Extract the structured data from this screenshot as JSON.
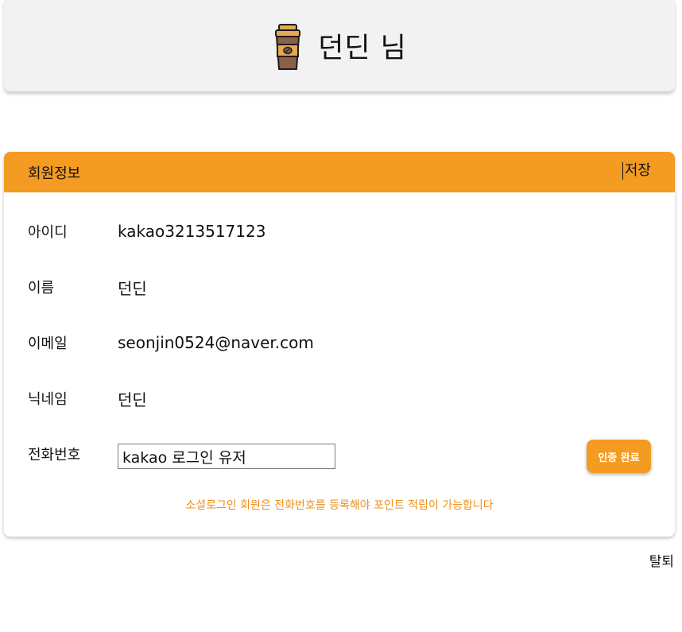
{
  "header": {
    "icon": "coffee-cup-icon",
    "title": "던딘 님"
  },
  "profile": {
    "section_title": "회원정보",
    "save_label": "저장",
    "fields": [
      {
        "label": "아이디",
        "value": "kakao3213517123"
      },
      {
        "label": "이름",
        "value": "던딘"
      },
      {
        "label": "이메일",
        "value": "seonjin0524@naver.com"
      },
      {
        "label": "닉네임",
        "value": "던딘"
      }
    ],
    "phone": {
      "label": "전화번호",
      "value": "kakao 로그인 유저",
      "verify_label": "인증 완료"
    },
    "notice": "소셜로그인 회원은 전화번호를 등록해야 포인트 적립이 가능합니다"
  },
  "footer": {
    "withdraw_label": "탈퇴"
  },
  "colors": {
    "accent": "#f49b22",
    "header_bg": "#f2f2f2",
    "notice_text": "#f08f1a"
  }
}
